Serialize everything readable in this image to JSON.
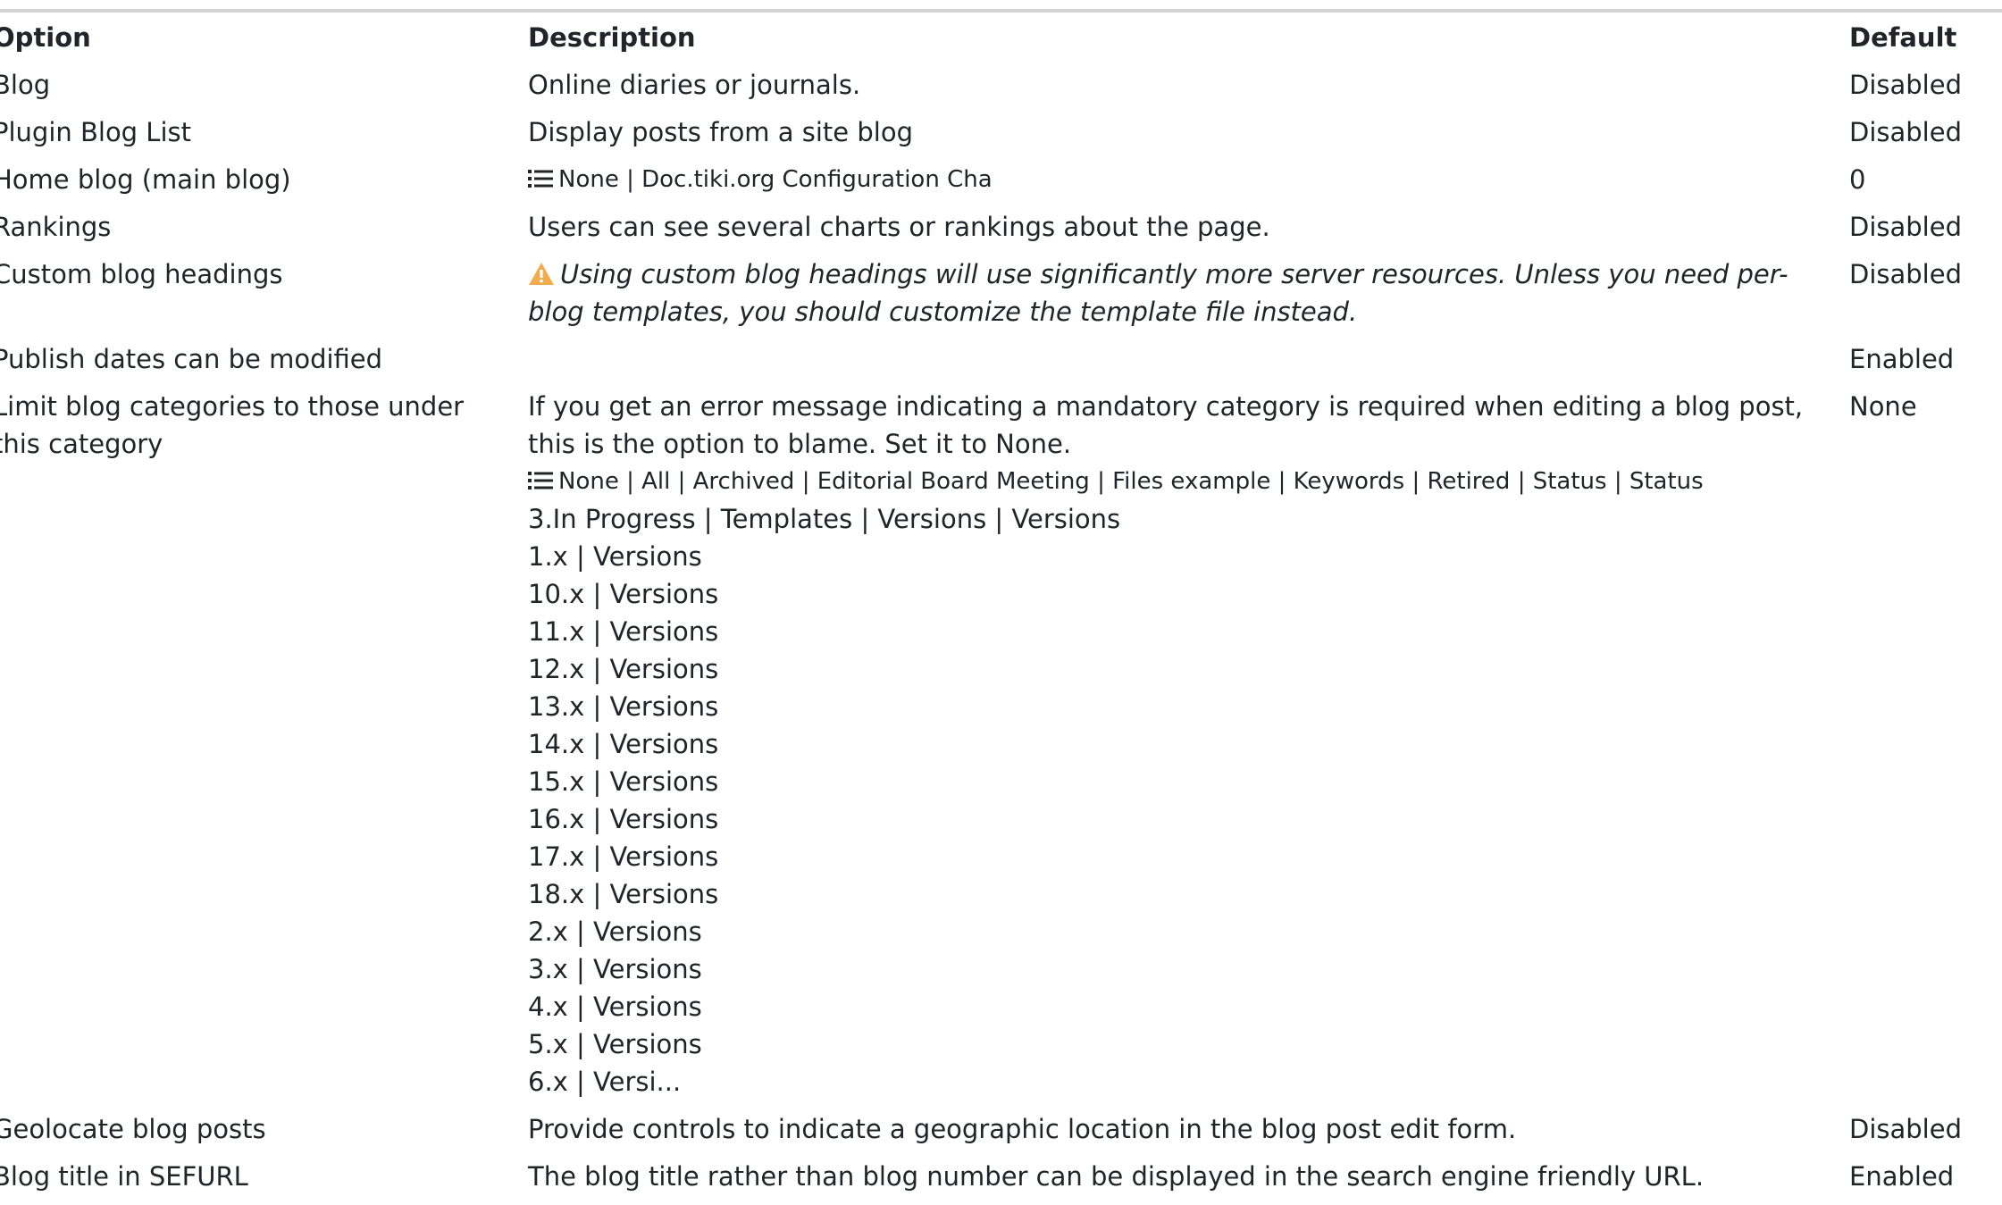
{
  "table": {
    "headers": {
      "option": "Option",
      "description": "Description",
      "default": "Default"
    },
    "rows": [
      {
        "option": "Blog",
        "description": "Online diaries or journals.",
        "default": "Disabled"
      },
      {
        "option": "Plugin Blog List",
        "description": "Display posts from a site blog",
        "default": "Disabled"
      },
      {
        "option": "Home blog (main blog)",
        "options_list": "None | Doc.tiki.org Configuration Cha",
        "default": "0"
      },
      {
        "option": "Rankings",
        "description": "Users can see several charts or rankings about the page.",
        "default": "Disabled"
      },
      {
        "option": "Custom blog headings",
        "warning": "Using custom blog headings will use significantly more server resources. Unless you need per-blog templates, you should customize the template file instead.",
        "warning_line1": "Using custom blog headings will use significantly more server resources. Unless you need per-",
        "warning_line2": "blog templates, you should customize the template file instead.",
        "default": "Disabled"
      },
      {
        "option": "Publish dates can be modified",
        "description": "",
        "default": "Enabled"
      },
      {
        "option": "Limit blog categories to those under this category",
        "option_line1": "Limit blog categories to those under",
        "option_line2": "this category",
        "description": "If you get an error message indicating a mandatory category is required when editing a blog post, this is the option to blame. Set it to None.",
        "description_line1": "If you get an error message indicating a mandatory category is required when editing a blog post,",
        "description_line2": "this is the option to blame. Set it to None.",
        "options_list": "None | All | Archived | Editorial Board Meeting | Files example | Keywords | Retired | Status | Status",
        "options_continued": [
          "3.In Progress | Templates | Versions | Versions",
          "1.x | Versions",
          "10.x | Versions",
          "11.x | Versions",
          "12.x | Versions",
          "13.x | Versions",
          "14.x | Versions",
          "15.x | Versions",
          "16.x | Versions",
          "17.x | Versions",
          "18.x | Versions",
          "2.x | Versions",
          "3.x | Versions",
          "4.x | Versions",
          "5.x | Versions",
          "6.x | Versi..."
        ],
        "default": "None"
      },
      {
        "option": "Geolocate blog posts",
        "description": "Provide controls to indicate a geographic location in the blog post edit form.",
        "default": "Disabled"
      },
      {
        "option": "Blog title in SEFURL",
        "description": "The blog title rather than blog number can be displayed in the search engine friendly URL.",
        "default": "Enabled"
      }
    ]
  },
  "icons": {
    "list": "list-icon",
    "warning": "warning-icon",
    "warning_color": "#f0ad4e"
  }
}
